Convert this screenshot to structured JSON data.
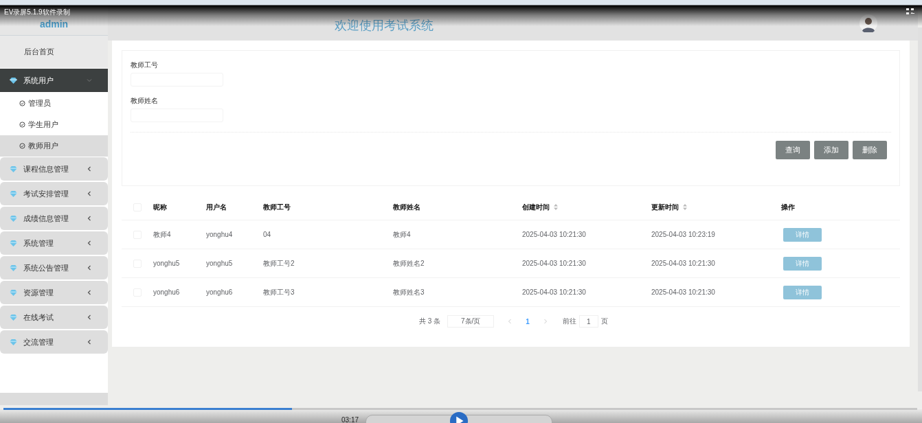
{
  "recorder": {
    "title": "EV录屏5.1.9软件录制",
    "time": "03:17",
    "progress": {
      "level": 0.316
    }
  },
  "sidebar": {
    "brand": "admin",
    "items": [
      {
        "label": "后台首页",
        "kind": "link",
        "selected": false
      },
      {
        "label": "系统用户",
        "kind": "group",
        "selected": true,
        "expanded": true,
        "children": [
          {
            "label": "管理员",
            "selected": false
          },
          {
            "label": "学生用户",
            "selected": false
          },
          {
            "label": "教师用户",
            "selected": true
          }
        ]
      },
      {
        "label": "课程信息管理",
        "kind": "group",
        "selected": false,
        "expanded": false
      },
      {
        "label": "考试安排管理",
        "kind": "group",
        "selected": false,
        "expanded": false
      },
      {
        "label": "成绩信息管理",
        "kind": "group",
        "selected": false,
        "expanded": false
      },
      {
        "label": "系统管理",
        "kind": "group",
        "selected": false,
        "expanded": false
      },
      {
        "label": "系统公告管理",
        "kind": "group",
        "selected": false,
        "expanded": false
      },
      {
        "label": "资源管理",
        "kind": "group",
        "selected": false,
        "expanded": false
      },
      {
        "label": "在线考试",
        "kind": "group",
        "selected": false,
        "expanded": false
      },
      {
        "label": "交流管理",
        "kind": "group",
        "selected": false,
        "expanded": false
      }
    ]
  },
  "header": {
    "title": "欢迎使用考试系统"
  },
  "search": {
    "fields": [
      {
        "label": "教师工号"
      },
      {
        "label": "教师姓名"
      }
    ],
    "buttons": [
      "查询",
      "添加",
      "删除"
    ]
  },
  "table": {
    "select_all_checked": false,
    "columns": [
      {
        "label": "昵称",
        "sortable": false
      },
      {
        "label": "用户名",
        "sortable": false
      },
      {
        "label": "教师工号",
        "sortable": false
      },
      {
        "label": "教师姓名",
        "sortable": false
      },
      {
        "label": "创建时间",
        "sortable": true
      },
      {
        "label": "更新时间",
        "sortable": true
      },
      {
        "label": "操作",
        "sortable": false
      }
    ],
    "rows": [
      {
        "checked": false,
        "cells": [
          "教师4",
          "yonghu4",
          "04",
          "教师4",
          "2025-04-03 10:21:30",
          "2025-04-03 10:23:19"
        ],
        "action": "详情"
      },
      {
        "checked": false,
        "cells": [
          "yonghu5",
          "yonghu5",
          "教师工号2",
          "教师姓名2",
          "2025-04-03 10:21:30",
          "2025-04-03 10:21:30"
        ],
        "action": "详情"
      },
      {
        "checked": false,
        "cells": [
          "yonghu6",
          "yonghu6",
          "教师工号3",
          "教师姓名3",
          "2025-04-03 10:21:30",
          "2025-04-03 10:21:30"
        ],
        "action": "详情"
      }
    ]
  },
  "pagination": {
    "total": "共 3 条",
    "page_size": "7条/页",
    "pages": [
      {
        "label": "1",
        "selected": true
      }
    ],
    "goto_label": "前往",
    "goto_value": "1",
    "page_unit": "页"
  }
}
